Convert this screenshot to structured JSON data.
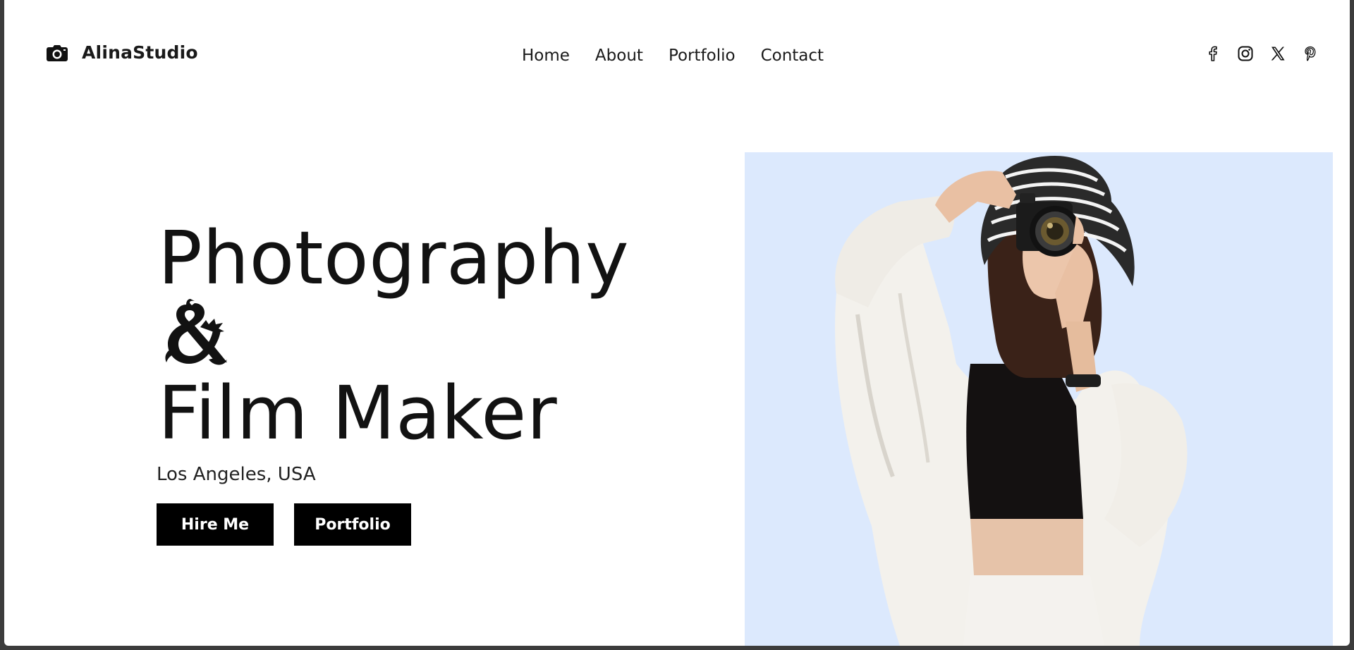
{
  "brand": {
    "name": "AlinaStudio",
    "icon": "camera-icon"
  },
  "nav": {
    "items": [
      "Home",
      "About",
      "Portfolio",
      "Contact"
    ]
  },
  "socials": [
    {
      "icon": "facebook-icon"
    },
    {
      "icon": "instagram-icon"
    },
    {
      "icon": "x-icon"
    },
    {
      "icon": "pinterest-icon"
    }
  ],
  "hero": {
    "line1": "Photography",
    "line2": "&",
    "line3": "Film Maker",
    "location": "Los Angeles, USA",
    "buttons": {
      "hire": "Hire Me",
      "portfolio": "Portfolio"
    }
  },
  "colors": {
    "accent": "#000000",
    "photo_bg": "#dce9fd",
    "text": "#121212"
  }
}
